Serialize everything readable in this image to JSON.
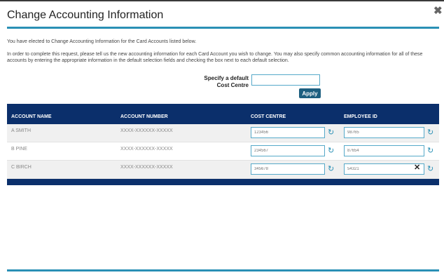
{
  "dialog": {
    "title": "Change Accounting Information",
    "close_glyph": "✖",
    "intro": "You have elected to Change Accounting Information for the Card Accounts listed below.",
    "description": "In order to complete this request, please tell us the new accounting information for each Card Account you wish to change. You may also specify common accounting information for all of these accounts by entering the appropriate information in the default selection fields and checking the box next to each default selection."
  },
  "default_cost_centre": {
    "label_line1": "Specify a default",
    "label_line2": "Cost Centre",
    "value": "",
    "apply_label": "Apply"
  },
  "table": {
    "headers": {
      "account_name": "ACCOUNT NAME",
      "account_number": "ACCOUNT NUMBER",
      "cost_centre": "COST CENTRE",
      "employee_id": "EMPLOYEE ID"
    },
    "rows": [
      {
        "name": "A SMITH",
        "number": "XXXX-XXXXXX-XXXXX",
        "cost_centre": "123456",
        "employee_id": "98765"
      },
      {
        "name": "B PINE",
        "number": "XXXX-XXXXXX-XXXXX",
        "cost_centre": "234567",
        "employee_id": "87654"
      },
      {
        "name": "C BIRCH",
        "number": "XXXX-XXXXXX-XXXXX",
        "cost_centre": "345678",
        "employee_id": "54321"
      }
    ]
  },
  "icons": {
    "reset": "↻",
    "clear": "✕"
  },
  "colors": {
    "accent": "#2a90b5",
    "header_navy": "#0b2f6b",
    "apply_button": "#1d5f80"
  }
}
